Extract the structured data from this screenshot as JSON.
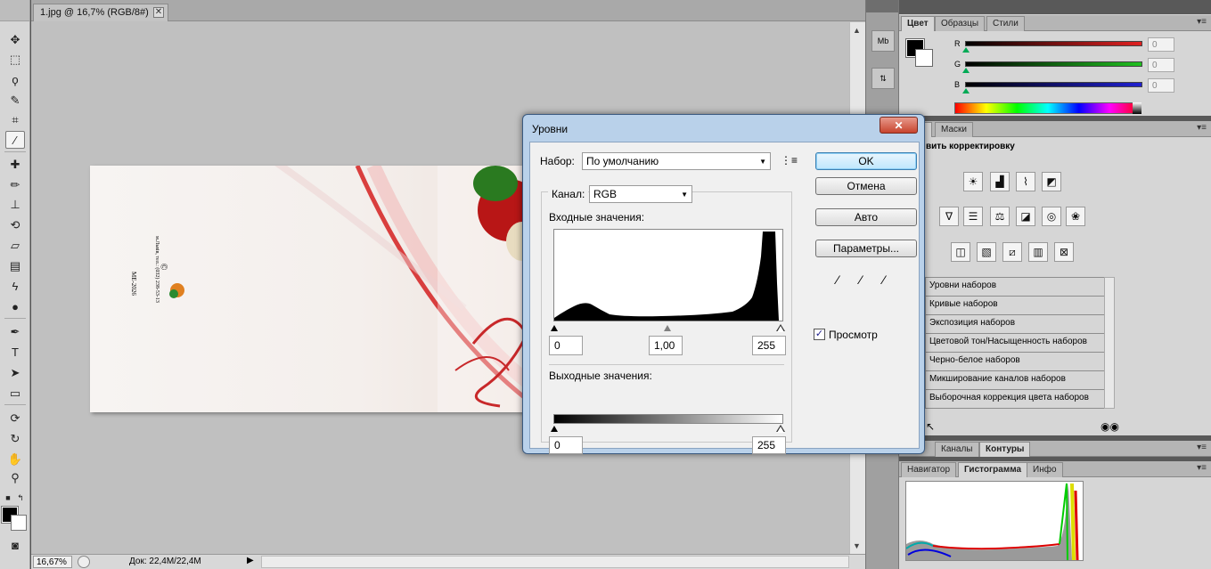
{
  "document": {
    "tab_title": "1.jpg @ 16,7% (RGB/8#)",
    "zoom": "16,67%",
    "doc_size": "Док: 22,4M/22,4M"
  },
  "toolbar": {
    "tools": [
      "move-icon",
      "marquee-icon",
      "lasso-icon",
      "quick-select-icon",
      "crop-icon",
      "eyedropper-icon",
      "healing-icon",
      "brush-icon",
      "stamp-icon",
      "history-brush-icon",
      "eraser-icon",
      "gradient-icon",
      "blur-icon",
      "dodge-icon",
      "pen-icon",
      "type-icon",
      "path-select-icon",
      "shape-icon",
      "3d-rotate-icon",
      "3d-orbit-icon",
      "hand-icon",
      "zoom-icon"
    ],
    "type_glyph": "T"
  },
  "color_panel": {
    "tabs": [
      "Цвет",
      "Образцы",
      "Стили"
    ],
    "sliders": [
      {
        "label": "R",
        "value": "0",
        "color": "#e02020"
      },
      {
        "label": "G",
        "value": "0",
        "color": "#20c020"
      },
      {
        "label": "B",
        "value": "0",
        "color": "#2020d0"
      }
    ]
  },
  "adjustments_panel": {
    "tabs": [
      "екция",
      "Маски"
    ],
    "heading": "вить корректировку",
    "presets": [
      "Уровни наборов",
      "Кривые наборов",
      "Экспозиция наборов",
      "Цветовой тон/Насыщенность наборов",
      "Черно-белое наборов",
      "Микширование каналов наборов",
      "Выборочная коррекция цвета наборов"
    ]
  },
  "layers_panel": {
    "tabs": [
      "Каналы",
      "Контуры"
    ]
  },
  "navigator_panel": {
    "tabs": [
      "Навигатор",
      "Гистограмма",
      "Инфо"
    ]
  },
  "levels_dialog": {
    "title": "Уровни",
    "close_label": "✕",
    "preset_label": "Набор:",
    "preset_value": "По умолчанию",
    "channel_label": "Канал:",
    "channel_value": "RGB",
    "input_label": "Входные значения:",
    "output_label": "Выходные значения:",
    "input_black": "0",
    "input_gamma": "1,00",
    "input_white": "255",
    "output_black": "0",
    "output_white": "255",
    "ok_label": "OK",
    "cancel_label": "Отмена",
    "auto_label": "Авто",
    "options_label": "Параметры...",
    "preview_label": "Просмотр",
    "preview_checked": true
  },
  "image_text": {
    "copyright": "©",
    "code": "МЕ-2026",
    "info": "м.Львів, тел.: (032) 238-53-13"
  }
}
